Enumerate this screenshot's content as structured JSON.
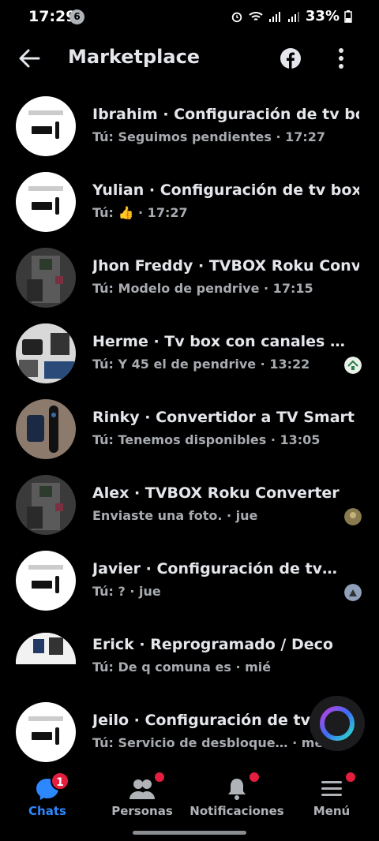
{
  "status_bar": {
    "time": "17:29",
    "notification_count": "6",
    "battery": "33%"
  },
  "header": {
    "title": "Marketplace",
    "icons": [
      "back-arrow-icon",
      "facebook-icon",
      "more-vertical-icon"
    ]
  },
  "conversations": [
    {
      "title": "Ibrahim · Configuración de tv box",
      "subtitle": "Tú: Seguimos pendientes · 17:27"
    },
    {
      "title": "Yulian · Configuración de tv box",
      "subtitle_prefix": "Tú:",
      "subtitle_suffix": "· 17:27",
      "emoji": "👍"
    },
    {
      "title": "Jhon Freddy · TVBOX Roku Conv…",
      "subtitle": "Tú: Modelo de pendrive · 17:15"
    },
    {
      "title": "Herme · Tv box con canales …",
      "subtitle": "Tú: Y 45 el de pendrive · 13:22"
    },
    {
      "title": "Rinky · Convertidor a TV Smart …",
      "subtitle": "Tú: Tenemos disponibles · 13:05"
    },
    {
      "title": "Alex · TVBOX Roku Converter",
      "subtitle": "Enviaste una foto. · jue"
    },
    {
      "title": "Javier · Configuración de tv…",
      "subtitle": "Tú: ? · jue"
    },
    {
      "title": "Erick · Reprogramado / Deco",
      "subtitle": "Tú: De q comuna es · mié"
    },
    {
      "title": "Jeilo · Configuración de tv b",
      "subtitle": "Tú: Servicio de desbloque…  · mé"
    }
  ],
  "nav": {
    "chats": {
      "label": "Chats",
      "badge": "1"
    },
    "people": {
      "label": "Personas"
    },
    "notifications": {
      "label": "Notificaciones"
    },
    "menu": {
      "label": "Menú"
    }
  },
  "colors": {
    "background": "#000000",
    "accent": "#2d88ff",
    "badge_red": "#e41e3f",
    "text_primary": "#e4e6eb",
    "text_secondary": "#a8abb0"
  }
}
